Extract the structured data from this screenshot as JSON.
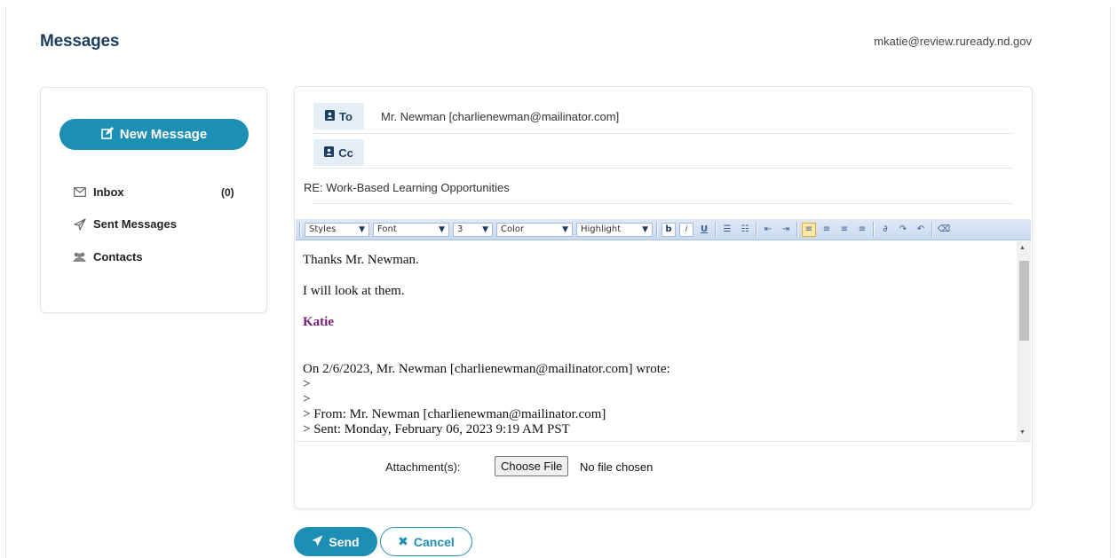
{
  "header": {
    "title": "Messages",
    "user_email": "mkatie@review.ruready.nd.gov"
  },
  "sidebar": {
    "new_message_label": "New Message",
    "items": [
      {
        "label": "Inbox",
        "icon": "envelope-icon",
        "count": "(0)"
      },
      {
        "label": "Sent Messages",
        "icon": "paper-plane-icon"
      },
      {
        "label": "Contacts",
        "icon": "users-icon"
      }
    ]
  },
  "compose": {
    "to_label": "To",
    "to_value": "Mr. Newman [charlienewman@mailinator.com]",
    "cc_label": "Cc",
    "cc_value": "",
    "subject": "RE: Work-Based Learning Opportunities",
    "toolbar": {
      "styles": "Styles",
      "font": "Font",
      "size": "3",
      "color": "Color",
      "highlight": "Highlight"
    },
    "body": {
      "line1": "Thanks Mr. Newman.",
      "line2": "I will look at them.",
      "signature": "Katie",
      "quote_header": "On 2/6/2023, Mr. Newman [charlienewman@mailinator.com] wrote:",
      "quote_lines": [
        ">",
        ">",
        "> From: Mr. Newman [charlienewman@mailinator.com]",
        "> Sent: Monday, February 06, 2023 9:19 AM PST"
      ]
    },
    "attachment_label": "Attachment(s):",
    "choose_file_label": "Choose File",
    "file_status": "No file chosen"
  },
  "actions": {
    "send_label": "Send",
    "cancel_label": "Cancel"
  },
  "colors": {
    "primary": "#1e8fb4",
    "title": "#1b3e5e",
    "signature": "#7a1a78"
  }
}
